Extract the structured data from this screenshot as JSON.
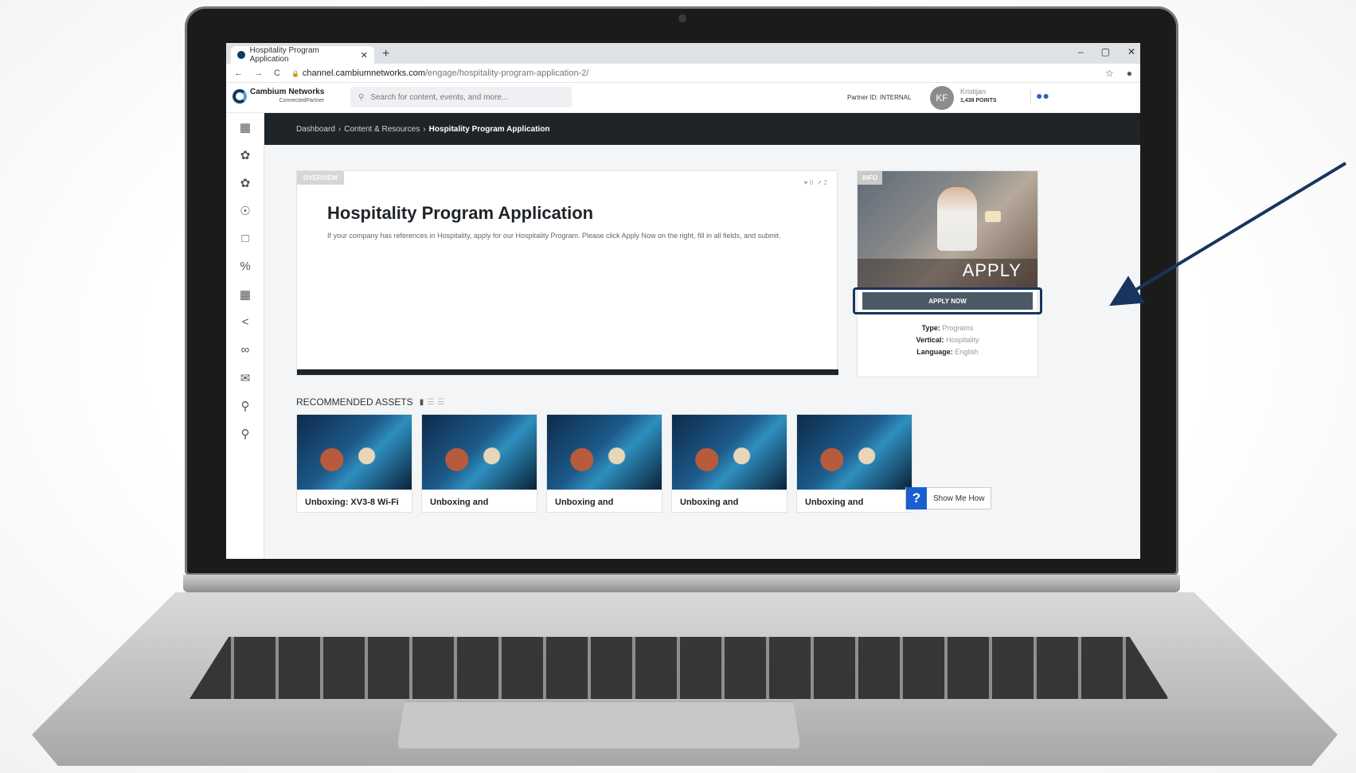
{
  "browser": {
    "tab_title": "Hospitality Program Application",
    "tab_close": "✕",
    "new_tab": "+",
    "url_host": "channel.cambiumnetworks.com",
    "url_path": "/engage/hospitality-program-application-2/",
    "back": "←",
    "forward": "→",
    "reload": "C",
    "lock": "🔒",
    "star": "☆",
    "window_controls": [
      "–",
      "▢",
      "✕"
    ]
  },
  "header": {
    "logo_name": "Cambium Networks",
    "logo_sub": "ConnectedPartner",
    "search_placeholder": "Search for content, events, and more...",
    "partner_id": "Partner ID: INTERNAL",
    "avatar_initials": "KF",
    "user_name": "Kristijan",
    "user_points": "1,438 POINTS"
  },
  "sidebar": {
    "items": [
      "dashboard-icon",
      "megaphone-icon",
      "megaphone-alt-icon",
      "lightbulb-icon",
      "chat-icon",
      "percent-icon",
      "calendar-icon",
      "share-icon",
      "handshake-icon",
      "mail-icon",
      "search-doc-icon",
      "search-doc-alt-icon"
    ]
  },
  "breadcrumb": {
    "items": [
      "Dashboard",
      "Content & Resources"
    ],
    "separator": "›",
    "current": "Hospitality Program Application"
  },
  "overview": {
    "badge": "OVERVIEW",
    "likes": "0",
    "shares": "2",
    "title": "Hospitality Program Application",
    "description": "If your company has references in Hospitality, apply for our Hospitality Program. Please click Apply Now on the right, fill in all fields, and submit."
  },
  "info": {
    "badge": "INFO",
    "image_text": "APPLY",
    "apply_button": "APPLY NOW",
    "type_label": "Type:",
    "type_value": "Programs",
    "vertical_label": "Vertical:",
    "vertical_value": "Hospitality",
    "language_label": "Language:",
    "language_value": "English"
  },
  "recommended": {
    "title": "RECOMMENDED ASSETS",
    "cards": [
      {
        "title": "Unboxing: XV3-8 Wi-Fi"
      },
      {
        "title": "Unboxing and"
      },
      {
        "title": "Unboxing and"
      },
      {
        "title": "Unboxing and"
      },
      {
        "title": "Unboxing and"
      }
    ]
  },
  "help": {
    "icon": "?",
    "label": "Show Me How"
  },
  "colors": {
    "accent_dark": "#1f2429",
    "apply_button": "#4c5a68",
    "annotation": "#17355e",
    "help_blue": "#1a5fd0"
  }
}
